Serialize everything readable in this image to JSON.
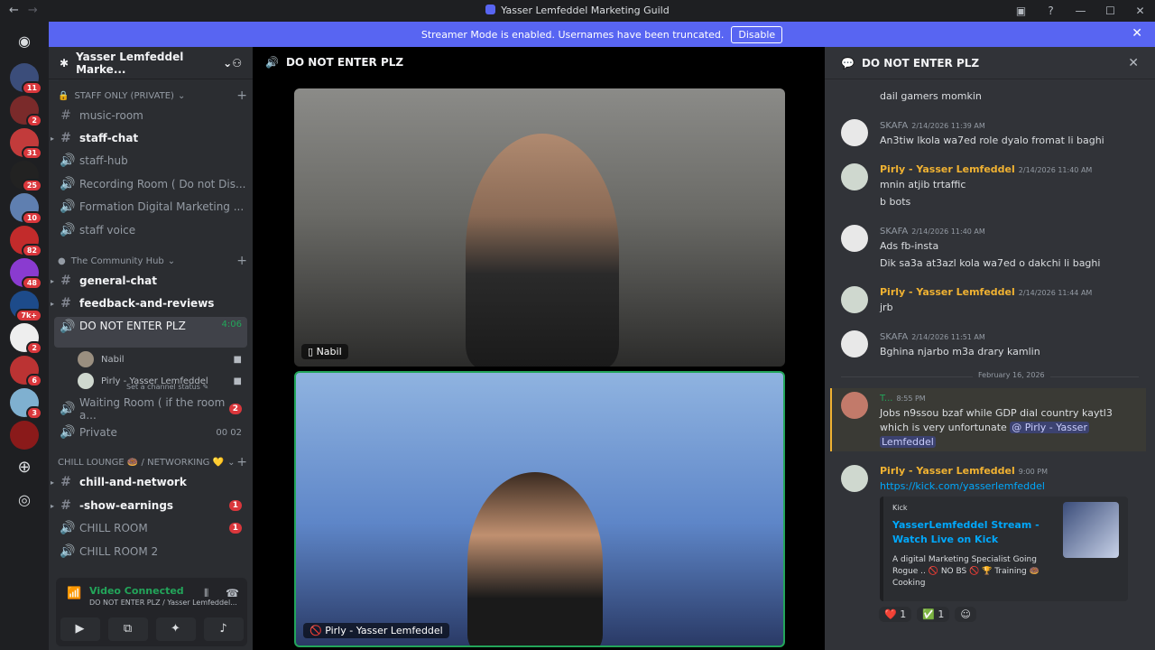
{
  "window": {
    "title": "Yasser Lemfeddel Marketing Guild"
  },
  "banner": {
    "text": "Streamer Mode is enabled. Usernames have been truncated.",
    "button": "Disable"
  },
  "servers": [
    {
      "badge": "11",
      "color": "#3b4d7a"
    },
    {
      "badge": "2",
      "color": "#7a2a2a"
    },
    {
      "badge": "31",
      "color": "#c23b3b"
    },
    {
      "badge": "25",
      "color": "#222"
    },
    {
      "badge": "10",
      "color": "#5f7fb0"
    },
    {
      "badge": "82",
      "color": "#c22b2b"
    },
    {
      "badge": "48",
      "color": "#8a3bd0"
    },
    {
      "badge": "7k+",
      "color": "#1d4b8a"
    },
    {
      "badge": "2",
      "color": "#eee"
    },
    {
      "badge": "6",
      "color": "#b33"
    },
    {
      "badge": "3",
      "color": "#7fb0d0"
    },
    {
      "badge": "",
      "color": "#8a1a1a"
    }
  ],
  "server": {
    "name": "Yasser Lemfeddel Marke..."
  },
  "categories": {
    "staff": "STAFF ONLY (PRIVATE)",
    "community": "The Community Hub",
    "chill": "CHILL LOUNGE 🍩 / NETWORKING 💛"
  },
  "channels": {
    "music": "music-room",
    "staff_chat": "staff-chat",
    "staff_hub": "staff-hub",
    "recording": "Recording Room ( Do not Dis...",
    "formation": "Formation Digital Marketing ...",
    "staff_voice": "staff voice",
    "general": "general-chat",
    "feedback": "feedback-and-reviews",
    "dnep": "DO NOT ENTER PLZ",
    "dnep_time": "4:06",
    "dnep_status": "Set a channel status",
    "waiting": "Waiting Room ( if the room a...",
    "waiting_badge": "2",
    "private": "Private",
    "private_count": "00",
    "private_count2": "02",
    "chill_network": "chill-and-network",
    "show_earnings": "-show-earnings",
    "show_earnings_badge": "1",
    "chill_room": "CHILL ROOM",
    "chill_room_badge": "1",
    "chill_room2": "CHILL ROOM 2"
  },
  "voice_users": [
    {
      "name": "Nabil"
    },
    {
      "name": "Pirly - Yasser Lemfeddel"
    }
  ],
  "voice_panel": {
    "status": "Video Connected",
    "sub": "DO NOT ENTER PLZ / Yasser Lemfeddel..."
  },
  "main": {
    "title": "DO NOT ENTER PLZ",
    "tile1_name": "Nabil",
    "tile2_name": "Pirly - Yasser Lemfeddel"
  },
  "chat": {
    "title": "DO NOT ENTER PLZ",
    "top_lines": [
      "dail gamers momkin"
    ],
    "messages": [
      {
        "author": "SKAFA",
        "time": "2/14/2026 11:39 AM",
        "lines": [
          "An3tiw lkola wa7ed role dyalo fromat li baghi"
        ]
      },
      {
        "author": "Pirly - Yasser Lemfeddel",
        "time": "2/14/2026 11:40 AM",
        "lines": [
          "mnin atjib trtaffic",
          "b bots"
        ]
      },
      {
        "author": "SKAFA",
        "time": "2/14/2026 11:40 AM",
        "lines": [
          "Ads fb-insta",
          "Dik sa3a at3azl kola wa7ed o dakchi li baghi"
        ]
      },
      {
        "author": "Pirly - Yasser Lemfeddel",
        "time": "2/14/2026 11:44 AM",
        "lines": [
          "jrb"
        ]
      },
      {
        "author": "SKAFA",
        "time": "2/14/2026 11:51 AM",
        "lines": [
          "Bghina njarbo m3a drary kamlin"
        ]
      }
    ],
    "date_divider": "February 16, 2026",
    "highlight": {
      "author": "T...",
      "time": "8:55 PM",
      "line1": "Jobs n9ssou bzaf while GDP dial country kaytl3",
      "line2": "which is very unfortunate",
      "mention": "@ Pirly - Yasser",
      "mention2": "Lemfeddel"
    },
    "last": {
      "author": "Pirly - Yasser Lemfeddel",
      "time": "9:00 PM",
      "link": "https://kick.com/yasserlemfeddel",
      "embed_provider": "Kick",
      "embed_title": "YasserLemfeddel Stream - Watch Live on Kick",
      "embed_desc": "A digital Marketing Specialist Going Rogue .. 🚫 NO BS 🚫 🏆 Training 🍩 Cooking"
    },
    "reactions": [
      {
        "emoji": "❤️",
        "count": "1"
      },
      {
        "emoji": "✅",
        "count": "1"
      },
      {
        "emoji": "☺",
        "count": ""
      }
    ]
  }
}
